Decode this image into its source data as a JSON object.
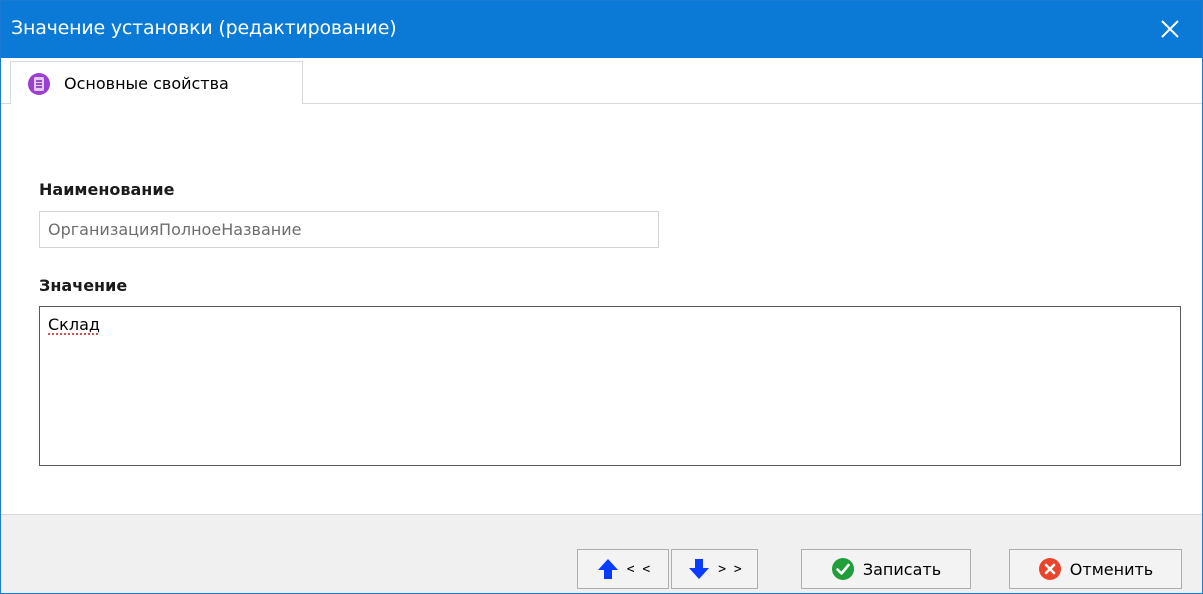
{
  "window": {
    "title": "Значение установки (редактирование)",
    "accent_color": "#0a7ad6"
  },
  "tabs": [
    {
      "label": "Основные свойства",
      "icon": "list-document-icon",
      "selected": true
    }
  ],
  "form": {
    "name_label": "Наименование",
    "name_value": "ОрганизацияПолноеНазвание",
    "value_label": "Значение",
    "value_text": "Склад"
  },
  "footer": {
    "prev_label": "< <",
    "next_label": "> >",
    "save_label": "Записать",
    "cancel_label": "Отменить"
  }
}
